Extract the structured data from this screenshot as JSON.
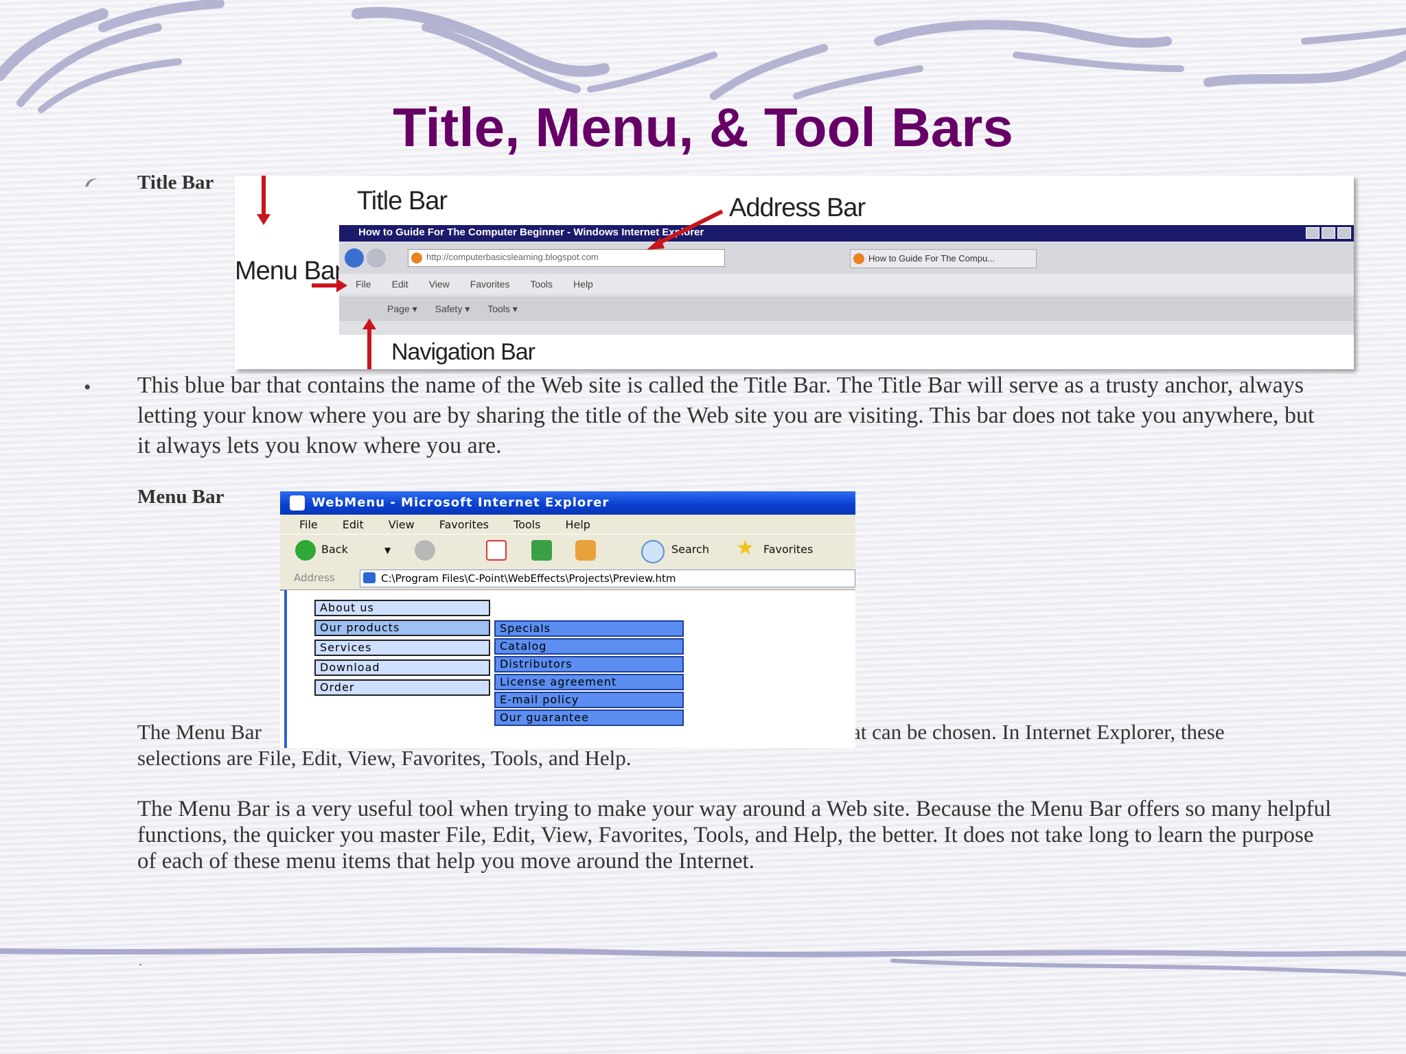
{
  "slide": {
    "title": "Title, Menu, & Tool Bars",
    "section1_label": "Title Bar",
    "paragraph1": "This blue bar that contains the name of the Web site is called the Title Bar. The Title Bar will serve as a trusty anchor, always letting your know where you are by sharing the title of the Web site you are visiting. This bar does not take you anywhere, but it always lets you know where you are.",
    "section2_label": "Menu Bar",
    "paragraph2_left": "The Menu Bar",
    "paragraph2_right": "at can be chosen. In Internet Explorer, these",
    "paragraph2_line2": "selections are File, Edit, View, Favorites, Tools, and Help.",
    "paragraph3": "The Menu Bar is a very useful tool when trying to make your way around a Web site. Because the Menu Bar offers so many helpful functions, the quicker you master File, Edit, View, Favorites, Tools, and Help, the better. It does not take long to learn the purpose of each of these menu items that help you move around the Internet.",
    "footer_mark": "."
  },
  "screenshot1": {
    "annotations": {
      "title_bar": "Title Bar",
      "address_bar": "Address Bar",
      "menu_bar": "Menu Bar",
      "navigation_bar": "Navigation Bar"
    },
    "window_title": "How to Guide For The Computer Beginner - Windows Internet Explorer",
    "address_url": "http://computerbasicslearning.blogspot.com",
    "tab_label": "How to Guide For The Compu...",
    "menu_items": [
      "File",
      "Edit",
      "View",
      "Favorites",
      "Tools",
      "Help"
    ],
    "command_items": [
      "Page ▾",
      "Safety ▾",
      "Tools ▾"
    ]
  },
  "screenshot2": {
    "window_title": "WebMenu - Microsoft Internet Explorer",
    "menu_items": [
      "File",
      "Edit",
      "View",
      "Favorites",
      "Tools",
      "Help"
    ],
    "toolbar": {
      "back_label": "Back",
      "search_label": "Search",
      "favorites_label": "Favorites"
    },
    "address_label": "Address",
    "address_value": "C:\\Program Files\\C-Point\\WebEffects\\Projects\\Preview.htm",
    "demo_menu": [
      "About us",
      "Our products",
      "Services",
      "Download",
      "Order"
    ],
    "demo_submenu": [
      "Specials",
      "Catalog",
      "Distributors",
      "License agreement",
      "E-mail policy",
      "Our guarantee"
    ]
  },
  "colors": {
    "title": "#660066",
    "swirl": "#a9a9cc",
    "arrow": "#c8151b",
    "xp_blue": "#0a3fcf",
    "submenu": "#5b8ef0"
  }
}
